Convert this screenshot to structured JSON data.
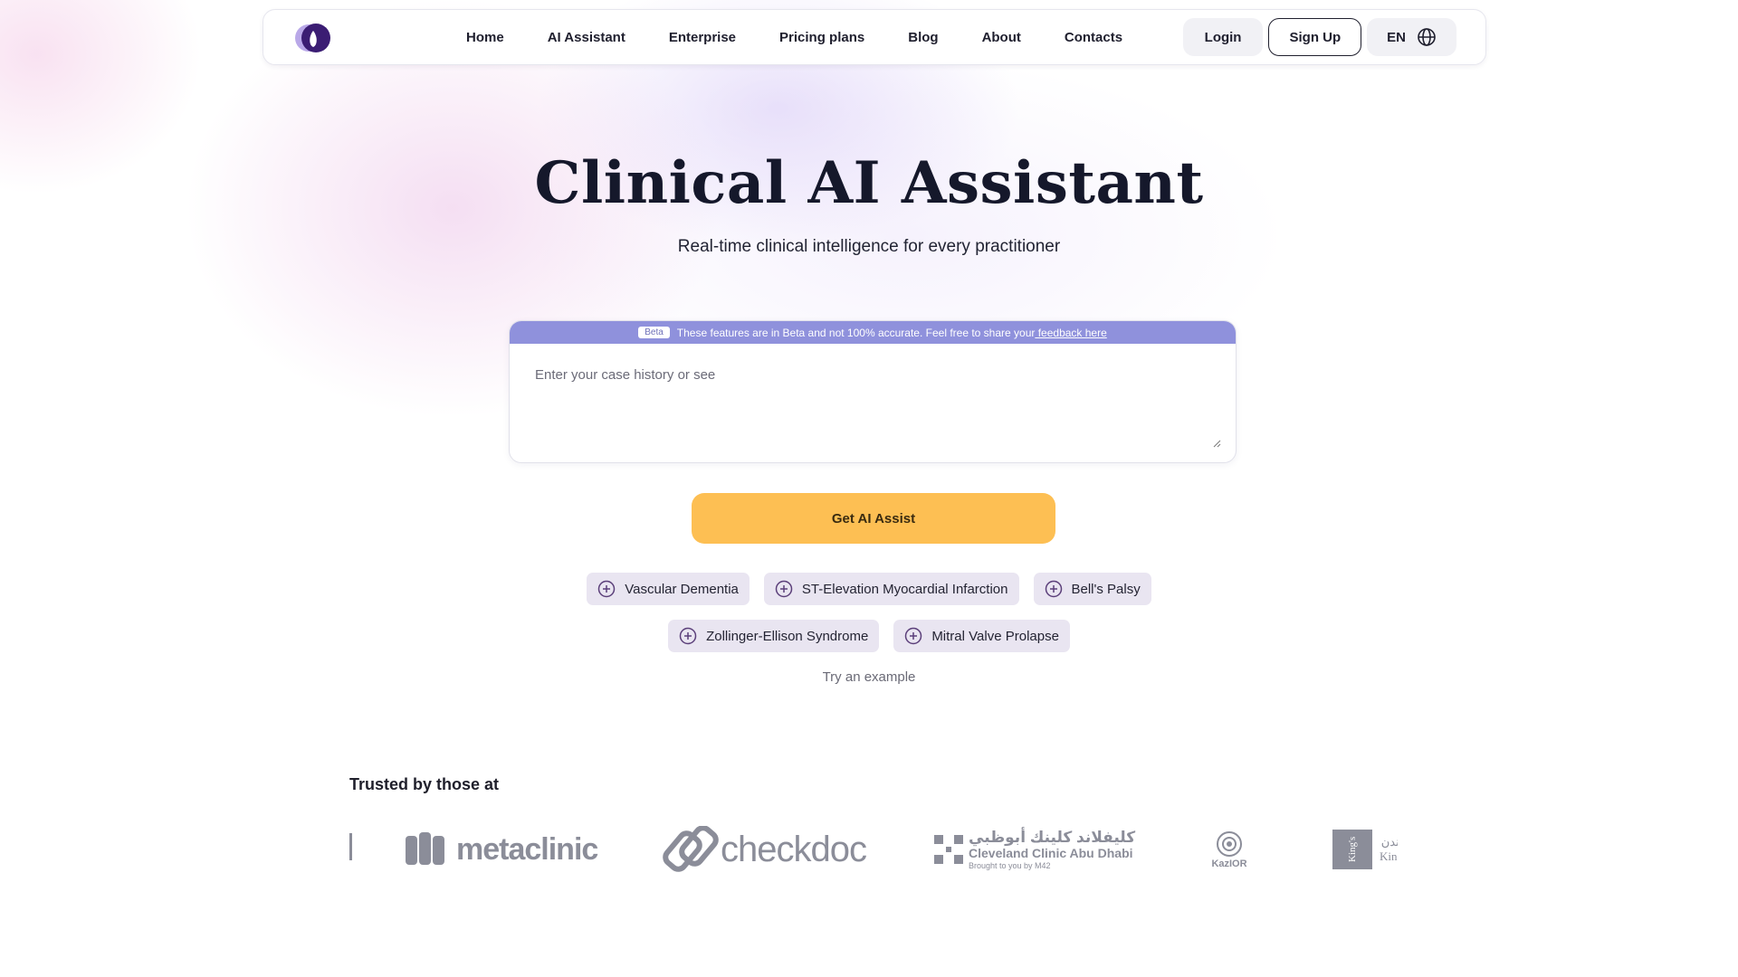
{
  "nav": {
    "links": [
      "Home",
      "AI Assistant",
      "Enterprise",
      "Pricing plans",
      "Blog",
      "About",
      "Contacts"
    ],
    "login_label": "Login",
    "signup_label": "Sign Up",
    "language_label": "EN"
  },
  "hero": {
    "title": "Clinical AI Assistant",
    "subtitle": "Real-time clinical intelligence for every practitioner"
  },
  "case_form": {
    "beta_badge": "Beta",
    "beta_notice": "These features are in Beta and not 100% accurate. Feel free to share your",
    "beta_link": " feedback here",
    "placeholder": "Enter your case history or see",
    "value": "",
    "submit_label": "Get AI Assist"
  },
  "examples": {
    "row1": [
      "Vascular Dementia",
      "ST-Elevation Myocardial Infarction",
      "Bell's Palsy"
    ],
    "row2": [
      "Zollinger-Ellison Syndrome",
      "Mitral Valve Prolapse"
    ],
    "caption": "Try an example"
  },
  "trusted": {
    "title": "Trusted by those at",
    "logos": {
      "metaclinic": "metaclinic",
      "checkdoc": "checkdoc",
      "cleveland_arabic": "كليفلاند كلينك أبوظبي",
      "cleveland_english": "Cleveland Clinic Abu Dhabi",
      "cleveland_sub": "Brought to you by M42",
      "kazior": "KazIOR",
      "kings_box": "King's",
      "kings_side_arabic": "لندن",
      "kings_side_english": "King"
    }
  },
  "colors": {
    "accent_purple": "#8f91dc",
    "button_yellow": "#fdbf53",
    "chip_bg": "#e9e5f1",
    "chip_icon": "#5b3f7a",
    "logo_dark": "#3b1d73",
    "logo_light": "#b9a8e8"
  }
}
